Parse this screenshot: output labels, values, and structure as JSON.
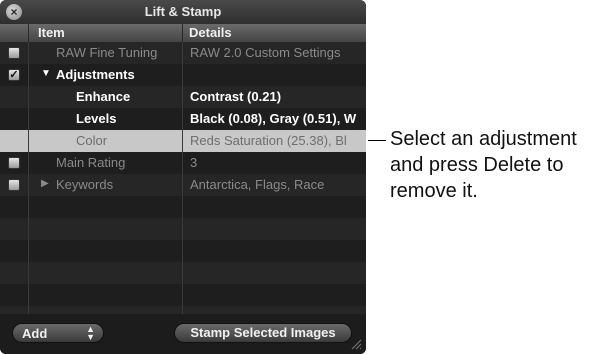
{
  "window": {
    "title": "Lift & Stamp"
  },
  "columns": {
    "item": "Item",
    "details": "Details"
  },
  "rows": [
    {
      "item": "RAW Fine Tuning",
      "details": "RAW 2.0 Custom Settings",
      "checkbox": "unchecked"
    },
    {
      "item": "Adjustments",
      "details": "",
      "checkbox": "checked",
      "expander": "expanded"
    },
    {
      "item": "Enhance",
      "details": "Contrast (0.21)"
    },
    {
      "item": "Levels",
      "details": "Black (0.08), Gray (0.51), W"
    },
    {
      "item": "Color",
      "details": "Reds Saturation (25.38), Bl",
      "selected": true
    },
    {
      "item": "Main Rating",
      "details": "3",
      "checkbox": "unchecked"
    },
    {
      "item": "Keywords",
      "details": "Antarctica, Flags, Race",
      "checkbox": "unchecked",
      "expander": "collapsed"
    }
  ],
  "footer": {
    "add_label": "Add",
    "stamp_label": "Stamp Selected Images"
  },
  "icons": {
    "close": "close-icon",
    "expanded": "triangle-down-icon",
    "collapsed": "triangle-right-icon",
    "checked": "checkmark-icon",
    "resize": "resize-grip-icon",
    "popup": "popup-arrows-icon"
  },
  "callout": {
    "lines": [
      "Select an adjustment",
      "and press Delete to",
      "remove it."
    ]
  }
}
